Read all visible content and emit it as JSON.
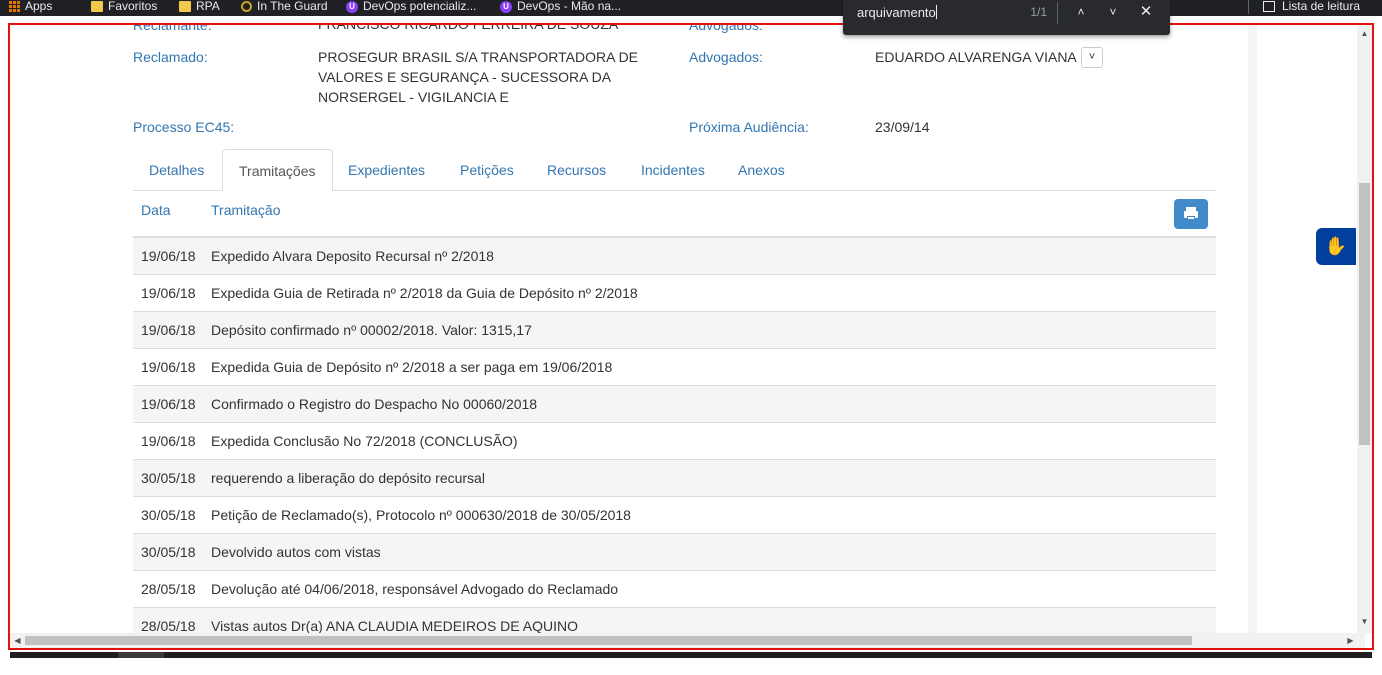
{
  "bookmarks": [
    {
      "label": "Apps",
      "icon": "apps-grid-icon"
    },
    {
      "label": "Favoritos",
      "icon": "folder-icon"
    },
    {
      "label": "RPA",
      "icon": "folder-icon"
    },
    {
      "label": "In The Guard",
      "icon": "guard-icon"
    },
    {
      "label": "DevOps potencializ...",
      "icon": "devops-icon"
    },
    {
      "label": "DevOps - Mão na...",
      "icon": "devops-icon"
    }
  ],
  "reading_list": {
    "label": "Lista de leitura",
    "icon": "reading-list-icon"
  },
  "find_bar": {
    "query": "arquivamento",
    "count": "1/1",
    "prev_icon": "chevron-up-icon",
    "next_icon": "chevron-down-icon",
    "close_icon": "close-icon"
  },
  "header_fields": {
    "reclamante_label": "Reclamante:",
    "reclamante_value": "FRANCISCO RICARDO FERREIRA DE SOUZA",
    "advogados_top_label": "Advogados:",
    "reclamado_label": "Reclamado:",
    "reclamado_value": [
      "PROSEGUR BRASIL S/A TRANSPORTADORA DE",
      "VALORES E SEGURANÇA - SUCESSORA DA",
      "NORSERGEL - VIGILANCIA E"
    ],
    "advogados_label": "Advogados:",
    "advogados_value": "EDUARDO ALVARENGA VIANA",
    "processo_label": "Processo EC45:",
    "proxima_label": "Próxima Audiência:",
    "proxima_value": "23/09/14"
  },
  "tabs": [
    {
      "label": "Detalhes",
      "active": false
    },
    {
      "label": "Tramitações",
      "active": true
    },
    {
      "label": "Expedientes",
      "active": false
    },
    {
      "label": "Petições",
      "active": false
    },
    {
      "label": "Recursos",
      "active": false
    },
    {
      "label": "Incidentes",
      "active": false
    },
    {
      "label": "Anexos",
      "active": false
    }
  ],
  "table": {
    "headers": {
      "data": "Data",
      "tramitacao": "Tramitação"
    },
    "print_icon": "print-icon",
    "rows": [
      {
        "data": "19/06/18",
        "tramitacao": "Expedido Alvara Deposito Recursal nº 2/2018"
      },
      {
        "data": "19/06/18",
        "tramitacao": "Expedida Guia de Retirada nº 2/2018 da Guia de Depósito nº 2/2018"
      },
      {
        "data": "19/06/18",
        "tramitacao": "Depósito confirmado nº 00002/2018. Valor: 1315,17"
      },
      {
        "data": "19/06/18",
        "tramitacao": "Expedida Guia de Depósito nº 2/2018 a ser paga em 19/06/2018"
      },
      {
        "data": "19/06/18",
        "tramitacao": "Confirmado o Registro do Despacho No 00060/2018"
      },
      {
        "data": "19/06/18",
        "tramitacao": "Expedida Conclusão No 72/2018 (CONCLUSÃO)"
      },
      {
        "data": "30/05/18",
        "tramitacao": "requerendo a liberação do depósito recursal"
      },
      {
        "data": "30/05/18",
        "tramitacao": "Petição de Reclamado(s), Protocolo nº 000630/2018 de 30/05/2018"
      },
      {
        "data": "30/05/18",
        "tramitacao": "Devolvido autos com vistas"
      },
      {
        "data": "28/05/18",
        "tramitacao": "Devolução até 04/06/2018, responsável Advogado do Reclamado"
      },
      {
        "data": "28/05/18",
        "tramitacao": "Vistas autos Dr(a) ANA CLAUDIA MEDEIROS DE AQUINO"
      }
    ]
  },
  "accessibility_button": {
    "icon": "sign-language-icon"
  },
  "colors": {
    "link": "#3276b1",
    "highlight_frame": "#e3120b",
    "print_button": "#428bca",
    "accessibility": "#003f9e"
  }
}
